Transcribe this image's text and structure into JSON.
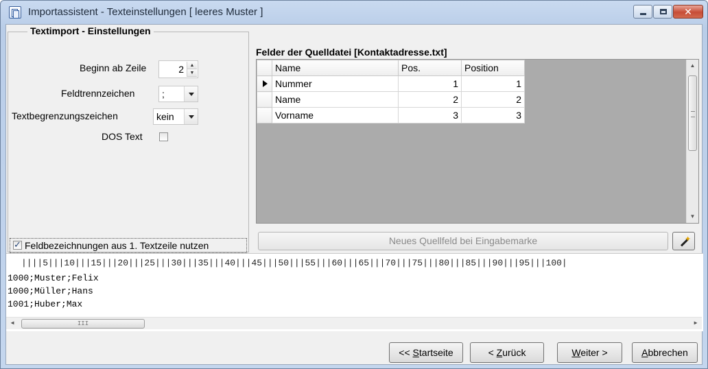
{
  "window": {
    "title": "Importassistent - Texteinstellungen [ leeres Muster ]",
    "close_symbol": "✕"
  },
  "settings": {
    "group_title": "Textimport - Einstellungen",
    "start_row_label": "Beginn ab Zeile",
    "start_row_value": "2",
    "field_separator_label": "Feldtrennzeichen",
    "field_separator_value": ";",
    "text_delimiter_label": "Textbegrenzungszeichen",
    "text_delimiter_value": "kein",
    "dos_text_label": "DOS Text",
    "dos_text_checked": false,
    "use_headers_label": "Feldbezeichnungen aus 1. Textzeile nutzen",
    "use_headers_checked": true
  },
  "fields": {
    "title": "Felder der Quelldatei [Kontaktadresse.txt]",
    "columns": [
      "Name",
      "Pos.",
      "Position"
    ],
    "rows": [
      {
        "name": "Nummer",
        "pos": "1",
        "position": "1"
      },
      {
        "name": "Name",
        "pos": "2",
        "position": "2"
      },
      {
        "name": "Vorname",
        "pos": "3",
        "position": "3"
      }
    ],
    "new_field_button": "Neues Quellfeld bei Eingabemarke"
  },
  "preview": {
    "ruler": "||||5|||10|||15|||20|||25|||30|||35|||40|||45|||50|||55|||60|||65|||70|||75|||80|||85|||90|||95|||100|",
    "lines": [
      "1000;Muster;Felix",
      "1000;Müller;Hans",
      "1001;Huber;Max"
    ],
    "scroll_thumb_glyph": "III"
  },
  "buttons": {
    "start": {
      "prefix": "<< ",
      "accel": "S",
      "rest": "tartseite"
    },
    "back": {
      "prefix": "< ",
      "accel": "Z",
      "rest": "urück"
    },
    "next": {
      "accel": "W",
      "rest": "eiter >"
    },
    "cancel": {
      "accel": "A",
      "rest": "bbrechen"
    }
  },
  "colors": {
    "title_bar": "#c4d6ee",
    "close_button": "#c74c36",
    "grid_background": "#ababab"
  }
}
